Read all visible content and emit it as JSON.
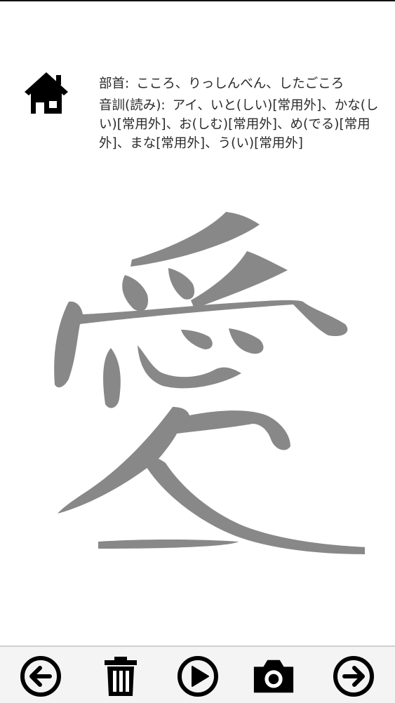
{
  "radical": {
    "label": "部首:",
    "value": "こころ、りっしんべん、したごころ"
  },
  "reading": {
    "label": "音訓(読み):",
    "value": "アイ、いと(しい)[常用外]、かな(しい)[常用外]、お(しむ)[常用外]、め(でる)[常用外]、まな[常用外]、う(い)[常用外]"
  },
  "kanji": "愛",
  "colors": {
    "kanji": "#888888",
    "icon": "#000000"
  },
  "icons": {
    "home": "home-icon",
    "previous": "arrow-left-circle-icon",
    "delete": "trash-icon",
    "play": "play-circle-icon",
    "camera": "camera-icon",
    "next": "arrow-right-circle-icon"
  }
}
